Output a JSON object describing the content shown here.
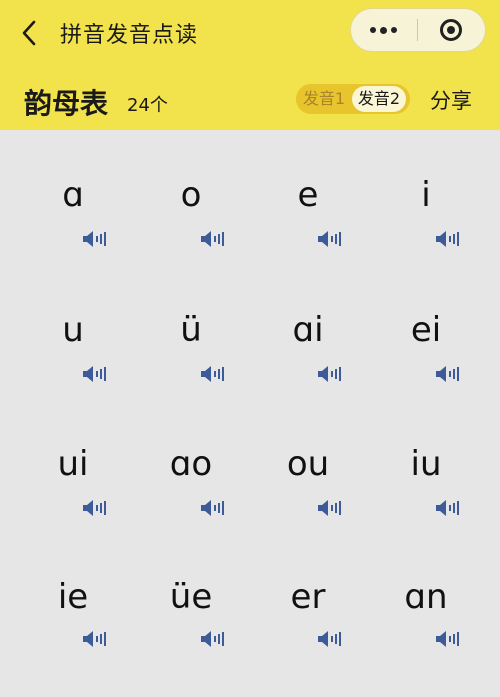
{
  "nav": {
    "title": "拼音发音点读"
  },
  "subheader": {
    "title": "韵母表",
    "count": "24个",
    "toggle": {
      "option1": "发音1",
      "option2": "发音2",
      "selected": "发音2"
    },
    "share_label": "分享"
  },
  "colors": {
    "header_bg": "#f2e24b",
    "toggle_bg": "#e8c52c",
    "speaker": "#3d5a99",
    "page_bg": "#e6e6e6"
  },
  "finals": [
    "ɑ",
    "o",
    "e",
    "i",
    "u",
    "ü",
    "ɑi",
    "ei",
    "ui",
    "ɑo",
    "ou",
    "iu",
    "ie",
    "üe",
    "er",
    "ɑn"
  ]
}
